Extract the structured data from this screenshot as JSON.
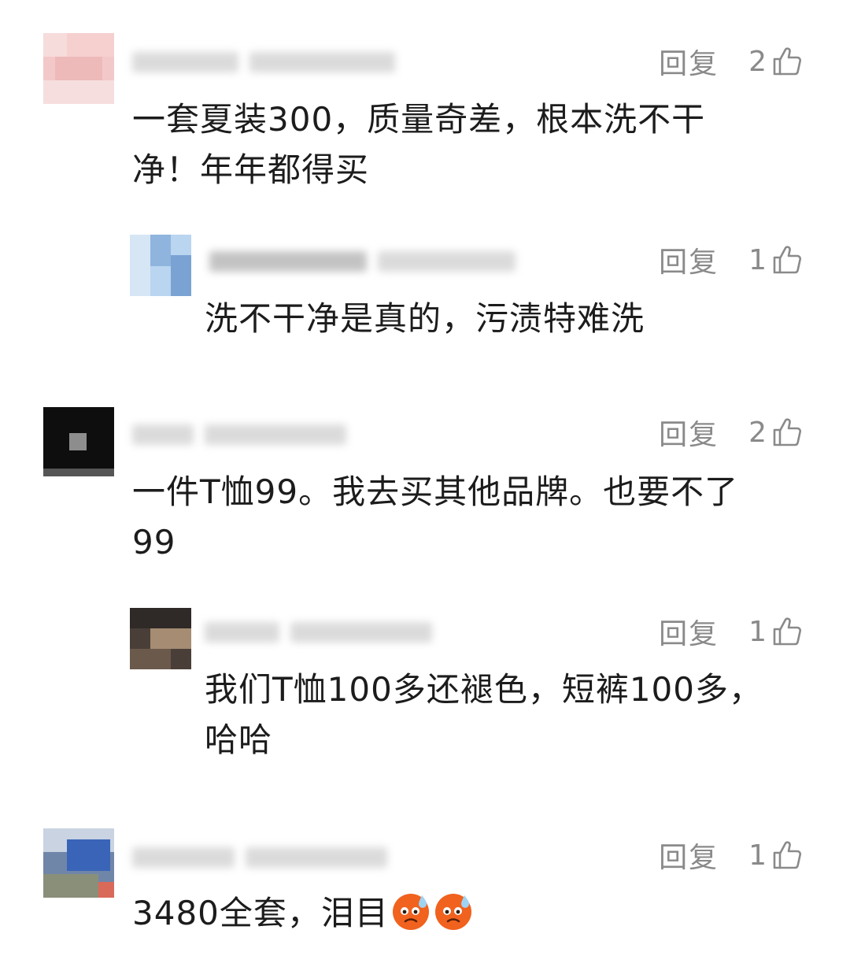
{
  "comments": [
    {
      "reply_label": "回复",
      "likes": "2",
      "lines": [
        "一套夏装300，质量奇差，根本洗不干",
        "净！年年都得买"
      ]
    },
    {
      "reply_label": "回复",
      "likes": "1",
      "lines": [
        "洗不干净是真的，污渍特难洗"
      ]
    },
    {
      "reply_label": "回复",
      "likes": "2",
      "lines": [
        "一件T恤99。我去买其他品牌。也要不了",
        "99"
      ]
    },
    {
      "reply_label": "回复",
      "likes": "1",
      "lines": [
        "我们T恤100多还褪色，短裤100多，",
        "哈哈"
      ]
    },
    {
      "reply_label": "回复",
      "likes": "1",
      "lines": [
        "3480全套，泪目"
      ]
    }
  ],
  "icons": {
    "like": "thumbs-up-icon",
    "emoji": "sweating-face-emoji"
  },
  "colors": {
    "action_text": "#8a8a8a",
    "body_text": "#1c1c1c",
    "emoji": "#f0621e"
  }
}
